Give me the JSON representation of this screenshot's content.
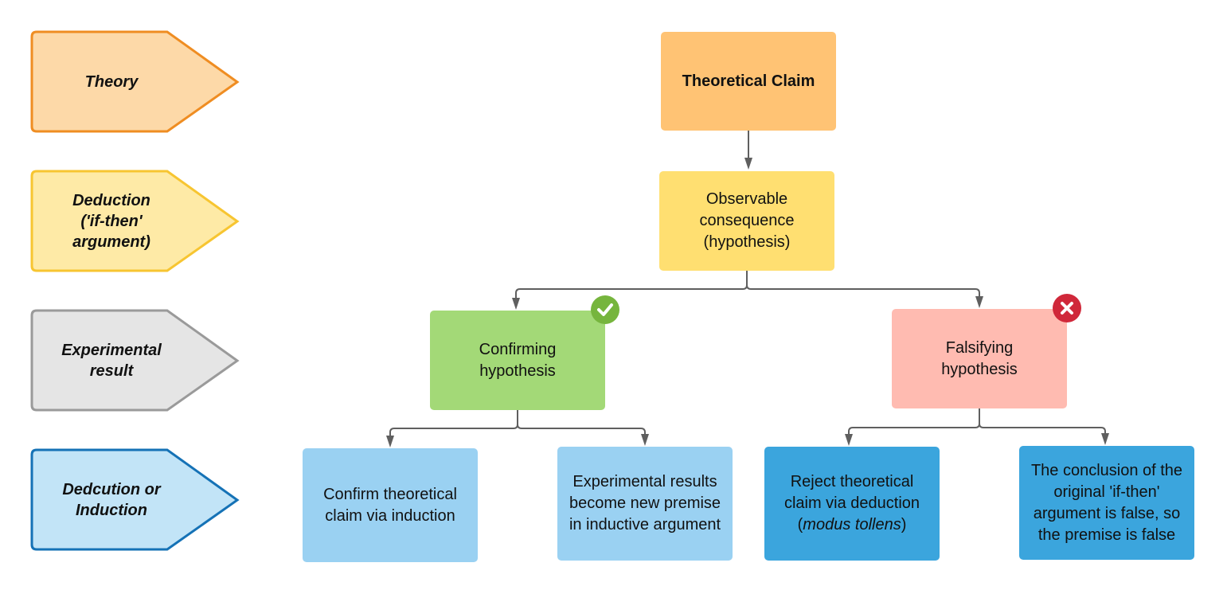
{
  "stages": [
    {
      "label": "Theory",
      "fill": "#fdd9a8",
      "stroke": "#ef8d22"
    },
    {
      "label": "Deduction ('if-then' argument)",
      "fill": "#feeaa6",
      "stroke": "#f7c531"
    },
    {
      "label": "Experimental result",
      "fill": "#e5e5e5",
      "stroke": "#9a9a9a"
    },
    {
      "label": "Dedcution or Induction",
      "fill": "#c2e4f7",
      "stroke": "#1572b6"
    }
  ],
  "nodes": {
    "claim": {
      "label": "Theoretical Claim",
      "fill": "#ffc374"
    },
    "hypothesis": {
      "label": "Observable consequence (hypothesis)",
      "fill": "#ffdf71"
    },
    "confirming": {
      "label": "Confirming hypothesis",
      "fill": "#a3d977",
      "badge": "check-icon",
      "badge_color": "#76b53d"
    },
    "falsifying": {
      "label": "Falsifying hypothesis",
      "fill": "#ffbbb1",
      "badge": "x-icon",
      "badge_color": "#d0283a"
    },
    "confirm_induction": {
      "label": "Confirm theoretical claim via induction",
      "fill": "#9ad1f2"
    },
    "new_premise": {
      "label": "Experimental results become new premise in inductive argument",
      "fill": "#9ad1f2"
    },
    "reject": {
      "label": "Reject theoretical claim via deduction",
      "label_italic": "modus tollens",
      "fill": "#3ba5dd"
    },
    "conclusion": {
      "label": "The conclusion of the original 'if-then' argument is false, so the premise is false",
      "fill": "#3ba5dd"
    }
  },
  "connector_color": "#5f5f5f"
}
